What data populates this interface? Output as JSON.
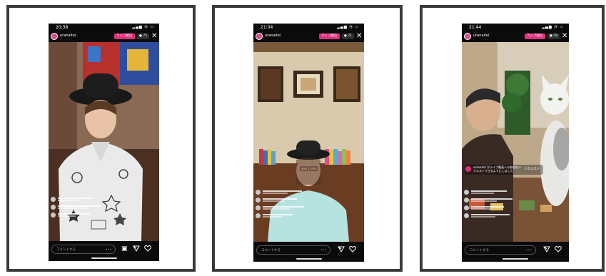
{
  "screens": [
    {
      "status_time": "20:38",
      "status_icons": "▂▄▆ ◔ ▭",
      "username": "uranaitei",
      "live_label": "ライブ配信",
      "viewers_label": "● 75",
      "close_glyph": "✕",
      "comment_placeholder": "コメントする",
      "more_glyph": "•••",
      "icons": [
        "question-box-icon",
        "send-icon",
        "heart-icon"
      ]
    },
    {
      "status_time": "21:04",
      "status_icons": "▂▄▆ ◔ ▭",
      "username": "uranaitei",
      "live_label": "ライブ配信",
      "viewers_label": "● 71",
      "close_glyph": "✕",
      "comment_placeholder": "コメントする",
      "more_glyph": "•••",
      "icons": [
        "send-icon",
        "heart-icon"
      ]
    },
    {
      "status_time": "21:44",
      "status_icons": "▂▄▆ ◔ ▭",
      "username": "uranaitei",
      "live_label": "ライブ配信",
      "viewers_label": "● 58",
      "close_glyph": "✕",
      "comment_placeholder": "コメントする",
      "more_glyph": "•••",
      "request_label": "リクエスト",
      "pinned_comment": "uranaitei がライブ動画への参加をリクエストできるようにしました",
      "icons": [
        "send-icon",
        "heart-icon"
      ]
    }
  ],
  "colors": {
    "live_pink": "#e0307d",
    "frame_border": "#3a3a3a"
  }
}
